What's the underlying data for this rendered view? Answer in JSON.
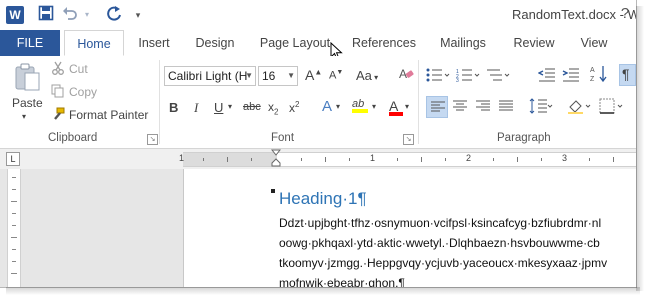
{
  "titlebar": {
    "app_logo": "W",
    "doc_title": "RandomText.docx - W",
    "icons": [
      "save-icon",
      "undo-icon",
      "redo-icon",
      "customize-qat-icon"
    ],
    "window_help": "?"
  },
  "tabs": {
    "file": "FILE",
    "items": [
      "Home",
      "Insert",
      "Design",
      "Page Layout",
      "References",
      "Mailings",
      "Review",
      "View"
    ],
    "active": "Home"
  },
  "clipboard": {
    "paste": "Paste",
    "cut": "Cut",
    "copy": "Copy",
    "format_painter": "Format Painter",
    "label": "Clipboard"
  },
  "font": {
    "font_name": "Calibri Light (H",
    "font_size": "16",
    "grow": "A",
    "shrink": "A",
    "change_case": "Aa",
    "bold": "B",
    "italic": "I",
    "underline": "U",
    "strikethrough": "abc",
    "subscript": "x",
    "superscript": "x",
    "text_effects": "A",
    "highlight": "ab",
    "font_color": "A",
    "label": "Font"
  },
  "paragraph": {
    "label": "Paragraph",
    "pilcrow": "¶"
  },
  "ruler": {
    "corner": "L",
    "numbers": [
      "1",
      "1",
      "2",
      "3"
    ]
  },
  "document": {
    "heading": "Heading·1¶",
    "lines": [
      "Ddzt·upjbght·tfhz·osnymuon·vcifpsl·ksincafcyg·bzfiubrdmr·nl",
      "oowg·pkhqaxl·ytd·aktic·wwetyl.·Dlqhbaezn·hsvbouwwme·cb",
      "tkoomyv·jzmgg.·Heppgvqy·ycjuvb·yaceoucx·mkesyxaaz·jpmv",
      "mofnwik·ebeabr·ghon.¶"
    ]
  },
  "colors": {
    "accent": "#2b579a",
    "heading": "#2e74b5",
    "highlight_yellow": "#ffff00",
    "font_red": "#ff0000"
  }
}
